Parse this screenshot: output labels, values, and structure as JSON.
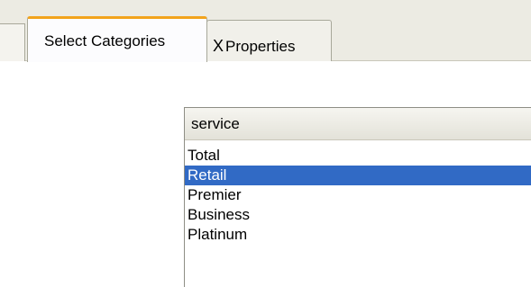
{
  "tabs": {
    "active_label": "Select Categories",
    "inactive_icon": "x-mark-icon",
    "inactive_x": "X",
    "inactive_label": "Properties"
  },
  "list": {
    "header": "service",
    "items": [
      "Total",
      "Retail",
      "Premier",
      "Business",
      "Platinum"
    ],
    "selected_index": 1,
    "selection_color": "#316ac5"
  },
  "colors": {
    "active_tab_accent": "#f2a31c"
  }
}
